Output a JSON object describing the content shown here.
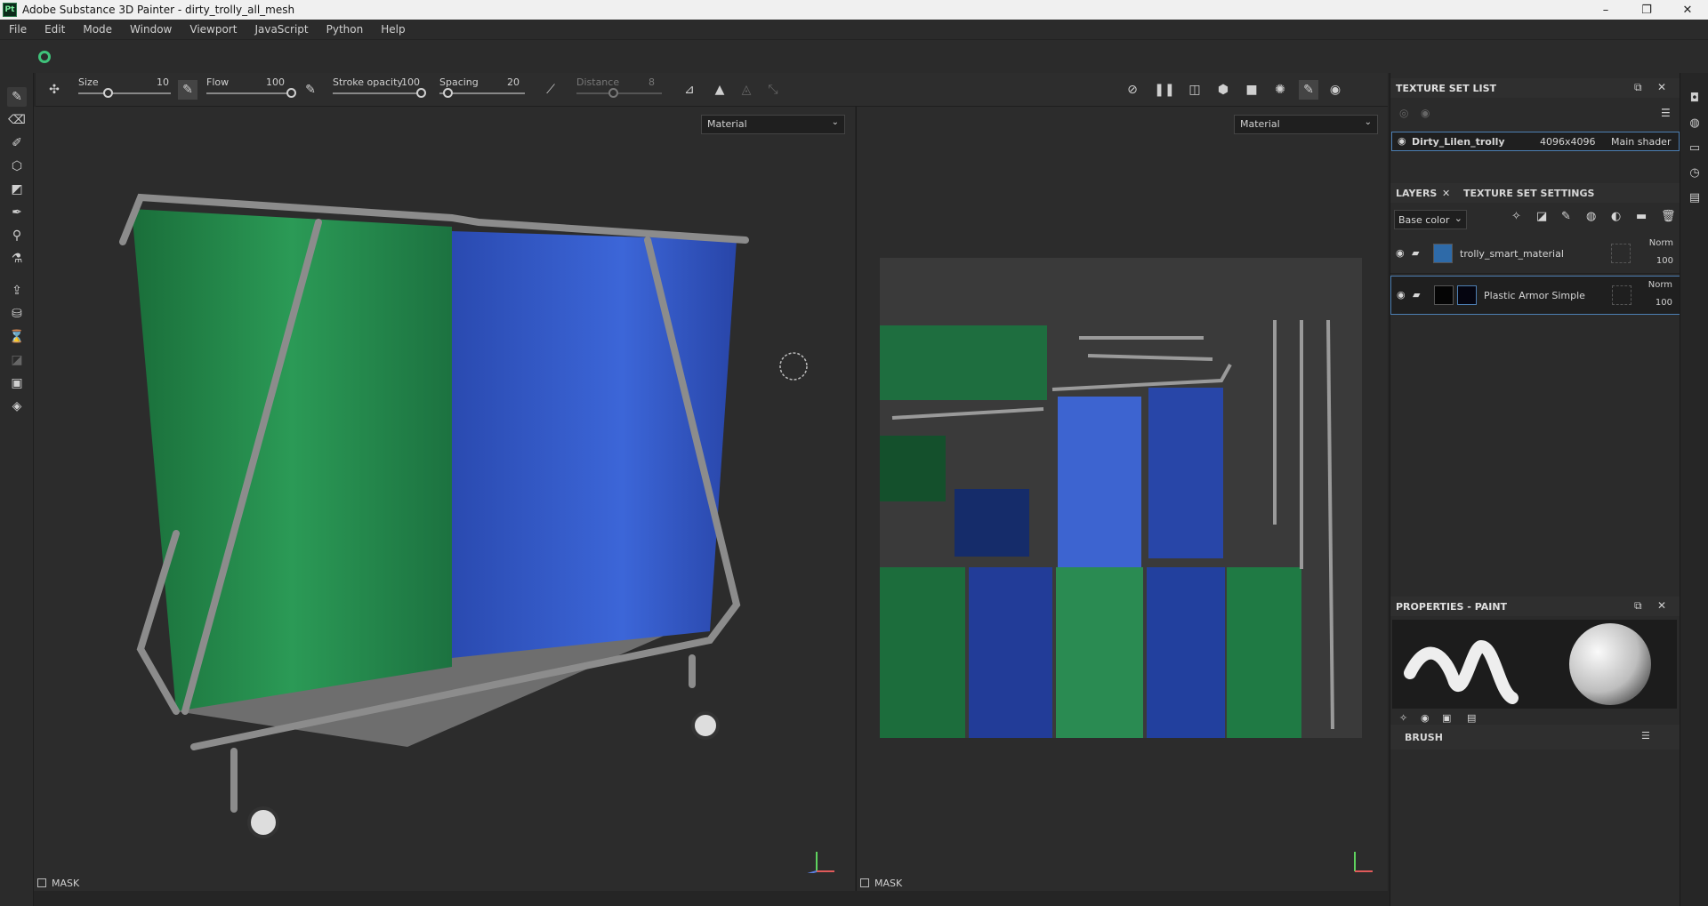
{
  "window": {
    "app_icon": "Pt",
    "title": "Adobe Substance 3D Painter - dirty_trolly_all_mesh",
    "minimize": "–",
    "restore": "❐",
    "close": "✕"
  },
  "menu": [
    "File",
    "Edit",
    "Mode",
    "Window",
    "Viewport",
    "JavaScript",
    "Python",
    "Help"
  ],
  "tool_options": {
    "size_label": "Size",
    "size_value": "10",
    "flow_label": "Flow",
    "flow_value": "100",
    "stroke_opacity_label": "Stroke opacity",
    "stroke_opacity_value": "100",
    "spacing_label": "Spacing",
    "spacing_value": "20",
    "distance_label": "Distance",
    "distance_value": "8"
  },
  "viewport3d": {
    "mode_select": "Material",
    "mask_label": "MASK"
  },
  "viewport2d": {
    "mode_select": "Material",
    "mask_label": "MASK"
  },
  "texture_set_list": {
    "title": "TEXTURE SET LIST",
    "item": {
      "name": "Dirty_Lilen_trolly",
      "resolution": "4096x4096",
      "shader": "Main shader"
    }
  },
  "layers_panel": {
    "tab_layers": "LAYERS",
    "tab_settings": "TEXTURE SET SETTINGS",
    "channel_select": "Base color",
    "layers": [
      {
        "name": "trolly_smart_material",
        "blend": "Norm",
        "opacity": "100"
      },
      {
        "name": "Plastic Armor Simple",
        "blend": "Norm",
        "opacity": "100"
      }
    ]
  },
  "properties": {
    "title": "PROPERTIES - PAINT",
    "brush_label": "BRUSH"
  },
  "colors": {
    "accent": "#4d7fb3",
    "green": "#1f8a4c",
    "blue": "#2a48b8",
    "bg": "#2c2c2c"
  }
}
